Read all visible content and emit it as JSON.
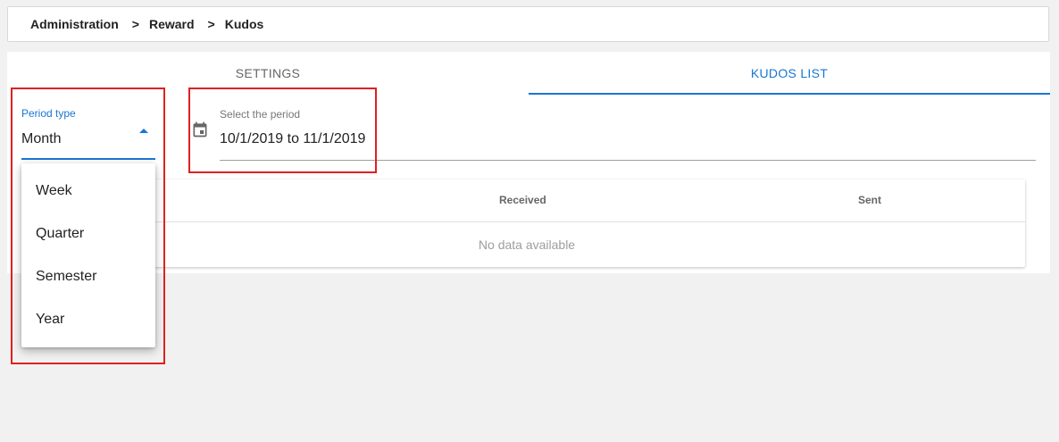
{
  "breadcrumb": {
    "items": [
      "Administration",
      "Reward",
      "Kudos"
    ],
    "separator": ">"
  },
  "tabs": [
    {
      "label": "SETTINGS",
      "active": false
    },
    {
      "label": "KUDOS LIST",
      "active": true
    }
  ],
  "period_select": {
    "label": "Period type",
    "value": "Month",
    "options": [
      "Week",
      "Quarter",
      "Semester",
      "Year"
    ]
  },
  "date_field": {
    "label": "Select the period",
    "value": "10/1/2019 to 11/1/2019",
    "icon": "calendar-icon"
  },
  "table": {
    "columns": [
      "",
      "Received",
      "Sent"
    ],
    "empty_text": "No data available"
  },
  "colors": {
    "accent": "#1976d2",
    "annotation": "#e02020",
    "page_background": "#f1f1f1"
  }
}
